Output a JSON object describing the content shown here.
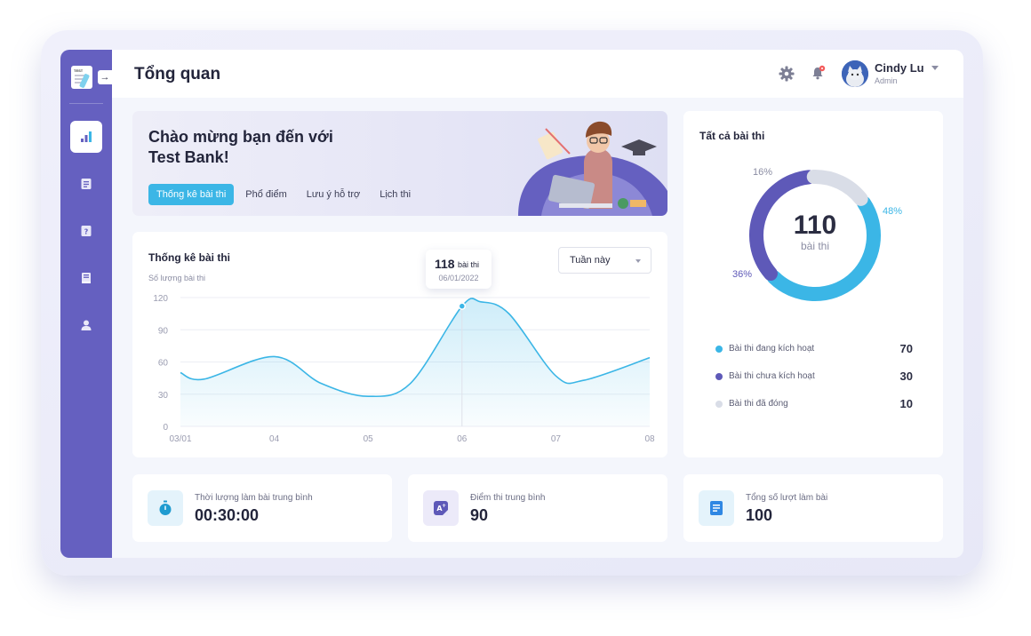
{
  "app": {
    "page_title": "Tổng quan",
    "user": {
      "name": "Cindy Lu",
      "role": "Admin"
    }
  },
  "sidebar": {
    "logo_tag": "TEST",
    "items": [
      {
        "icon": "bar-chart-icon",
        "active": true
      },
      {
        "icon": "document-icon",
        "active": false
      },
      {
        "icon": "question-book-icon",
        "active": false
      },
      {
        "icon": "book-icon",
        "active": false
      },
      {
        "icon": "user-icon",
        "active": false
      }
    ]
  },
  "banner": {
    "title_line1": "Chào mừng bạn đến với",
    "title_line2": "Test Bank!",
    "tabs": [
      {
        "label": "Thống kê bài thi",
        "active": true
      },
      {
        "label": "Phổ điểm",
        "active": false
      },
      {
        "label": "Lưu ý hỗ trợ",
        "active": false
      },
      {
        "label": "Lịch thi",
        "active": false
      }
    ]
  },
  "stats": {
    "title": "Thống kê bài thi",
    "dropdown_value": "Tuần này",
    "tooltip": {
      "value": "118",
      "unit": "bài thi",
      "date": "06/01/2022"
    }
  },
  "donut": {
    "title": "Tất cả bài thi",
    "total": "110",
    "total_unit": "bài thi",
    "legend": [
      {
        "label": "Bài thi đang kích hoạt",
        "value": "70",
        "color": "#3bb6e6"
      },
      {
        "label": "Bài thi chưa kích hoạt",
        "value": "30",
        "color": "#5e59b8"
      },
      {
        "label": "Bài thi đã đóng",
        "value": "10",
        "color": "#d9dde7"
      }
    ]
  },
  "kpis": [
    {
      "label": "Thời lượng làm bài trung bình",
      "value": "00:30:00",
      "icon": "stopwatch-icon"
    },
    {
      "label": "Điểm thi trung bình",
      "value": "90",
      "icon": "grade-icon"
    },
    {
      "label": "Tổng số lượt làm bài",
      "value": "100",
      "icon": "list-document-icon"
    }
  ],
  "chart_data": [
    {
      "type": "area",
      "title": "Thống kê bài thi",
      "ylabel": "Số lượng bài thi",
      "xlabel": "",
      "categories": [
        "03/01",
        "04",
        "05",
        "06",
        "07",
        "08"
      ],
      "y_ticks": [
        "0",
        "30",
        "60",
        "90",
        "120"
      ],
      "ylim": [
        0,
        120
      ],
      "x": [
        0,
        0.25,
        1.0,
        1.5,
        2.0,
        2.45,
        3.0,
        3.2,
        3.5,
        4.0,
        4.3,
        5.0
      ],
      "y": [
        50,
        44,
        65,
        40,
        28,
        40,
        112,
        116,
        105,
        47,
        43,
        64
      ],
      "color": "#3bb6e6",
      "grid": true
    },
    {
      "type": "pie",
      "title": "Tất cả bài thi",
      "labels": [
        "Bài thi đang kích hoạt",
        "Bài thi chưa kích hoạt",
        "Bài thi đã đóng"
      ],
      "values": [
        48,
        36,
        16
      ],
      "value_labels": [
        "48%",
        "36%",
        "16%"
      ],
      "colors": [
        "#3bb6e6",
        "#5e59b8",
        "#d9dde7"
      ]
    }
  ]
}
